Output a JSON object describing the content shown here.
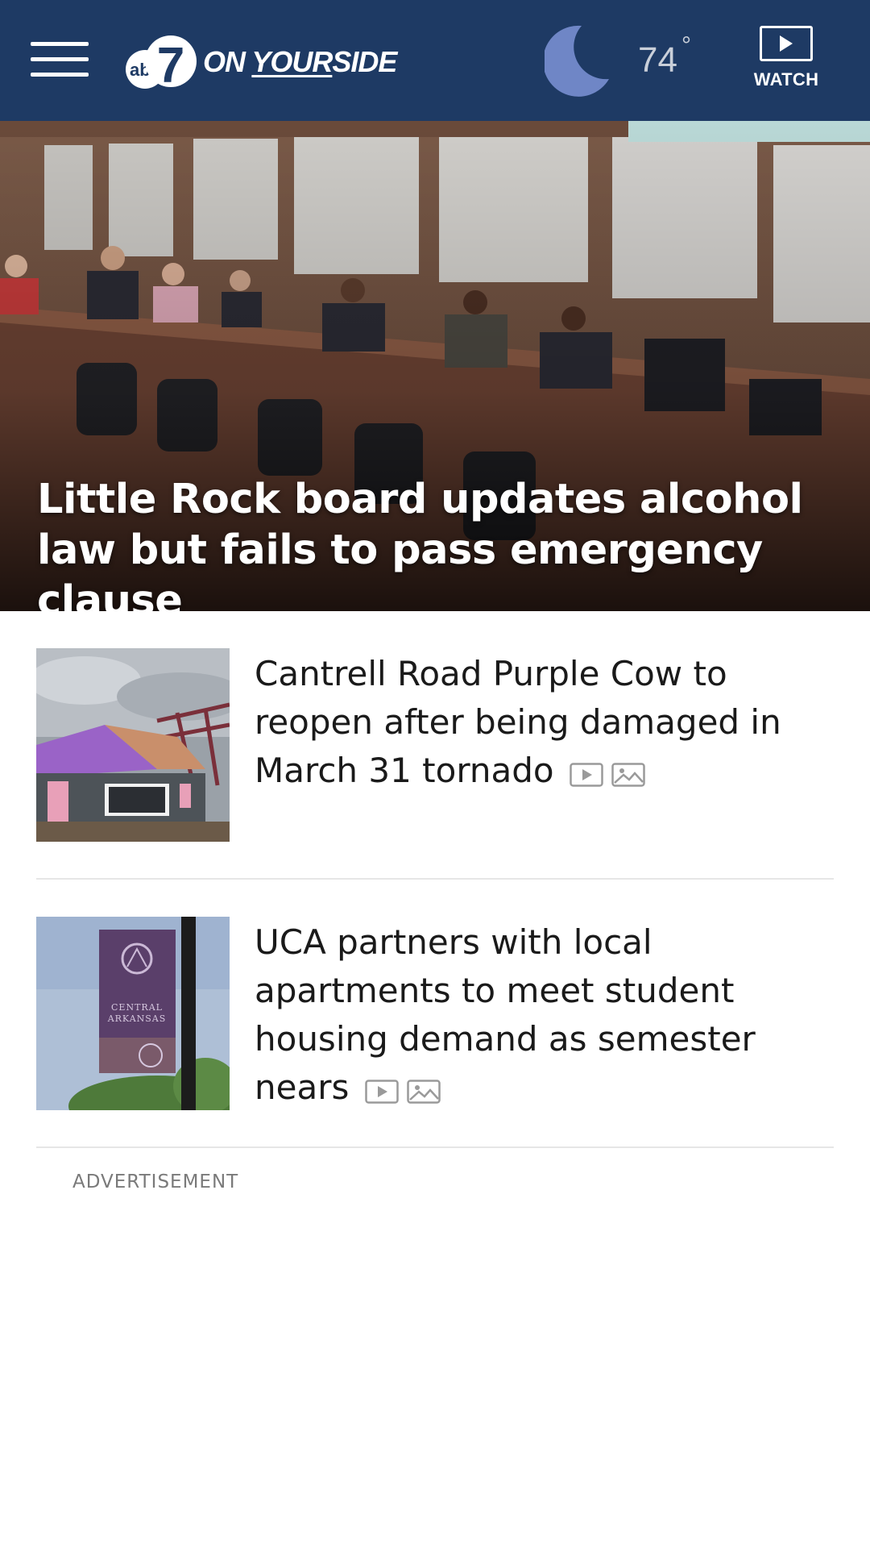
{
  "header": {
    "menu_icon": "hamburger-menu-icon",
    "logo": {
      "badge": "abc7",
      "text_on": "ON",
      "text_your": "YOUR",
      "text_side": "SIDE"
    },
    "weather": {
      "icon": "moon-icon",
      "temperature": "74",
      "degree_symbol": "°"
    },
    "watch": {
      "icon": "play-icon",
      "label": "WATCH"
    },
    "colors": {
      "background": "#1e3a64",
      "moon": "#6f86c6"
    }
  },
  "hero": {
    "headline": "Little Rock board updates alcohol law but fails to pass emergency clause",
    "image": "city-board-meeting-photo"
  },
  "stories": [
    {
      "title": "Cantrell Road Purple Cow to reopen after being damaged in March 31 tornado",
      "image": "purple-roof-building-photo",
      "media_icons": [
        "video-icon",
        "gallery-icon"
      ]
    },
    {
      "title": "UCA partners with local apartments to meet student housing demand as semester nears",
      "image": "central-arkansas-banner-photo",
      "banner_text": "CENTRAL ARKANSAS",
      "media_icons": [
        "video-icon",
        "gallery-icon"
      ]
    }
  ],
  "advertisement": {
    "label": "ADVERTISEMENT"
  }
}
